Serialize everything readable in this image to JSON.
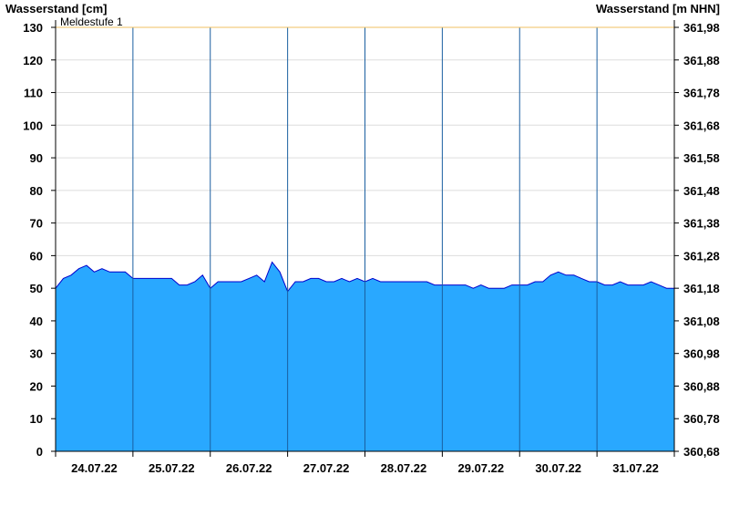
{
  "chart_data": {
    "type": "area",
    "ylabel": "Wasserstand [cm]",
    "ylabel_right": "Wasserstand [m NHN]",
    "ylim": [
      0,
      130
    ],
    "yticks": [
      0,
      10,
      20,
      30,
      40,
      50,
      60,
      70,
      80,
      90,
      100,
      110,
      120,
      130
    ],
    "yticks_right": [
      "360,68",
      "360,78",
      "360,88",
      "360,98",
      "361,08",
      "361,18",
      "361,28",
      "361,38",
      "361,48",
      "361,58",
      "361,68",
      "361,78",
      "361,88",
      "361,98"
    ],
    "xlim": [
      0,
      8
    ],
    "x_labels": [
      "24.07.22",
      "25.07.22",
      "26.07.22",
      "27.07.22",
      "28.07.22",
      "29.07.22",
      "30.07.22",
      "31.07.22"
    ],
    "threshold": {
      "label": "Meldestufe 1",
      "value": 130,
      "color": "#f0c060"
    },
    "grid": true,
    "colors": {
      "fill": "#29a8ff",
      "line": "#0000cc",
      "grid": "#dddddd",
      "day_line": "#1a5fa0"
    },
    "x": [
      0,
      0.1,
      0.2,
      0.3,
      0.4,
      0.5,
      0.6,
      0.7,
      0.8,
      0.9,
      1.0,
      1.1,
      1.2,
      1.3,
      1.4,
      1.5,
      1.6,
      1.7,
      1.8,
      1.9,
      2.0,
      2.1,
      2.2,
      2.3,
      2.4,
      2.5,
      2.6,
      2.7,
      2.8,
      2.9,
      3.0,
      3.1,
      3.2,
      3.3,
      3.4,
      3.5,
      3.6,
      3.7,
      3.8,
      3.9,
      4.0,
      4.1,
      4.2,
      4.3,
      4.4,
      4.5,
      4.6,
      4.7,
      4.8,
      4.9,
      5.0,
      5.1,
      5.2,
      5.3,
      5.4,
      5.5,
      5.6,
      5.7,
      5.8,
      5.9,
      6.0,
      6.1,
      6.2,
      6.3,
      6.4,
      6.5,
      6.6,
      6.7,
      6.8,
      6.9,
      7.0,
      7.1,
      7.2,
      7.3,
      7.4,
      7.5,
      7.6,
      7.7,
      7.8,
      7.9,
      8.0
    ],
    "y": [
      50,
      53,
      54,
      56,
      57,
      55,
      56,
      55,
      55,
      55,
      53,
      53,
      53,
      53,
      53,
      53,
      51,
      51,
      52,
      54,
      50,
      52,
      52,
      52,
      52,
      53,
      54,
      52,
      58,
      55,
      49,
      52,
      52,
      53,
      53,
      52,
      52,
      53,
      52,
      53,
      52,
      53,
      52,
      52,
      52,
      52,
      52,
      52,
      52,
      51,
      51,
      51,
      51,
      51,
      50,
      51,
      50,
      50,
      50,
      51,
      51,
      51,
      52,
      52,
      54,
      55,
      54,
      54,
      53,
      52,
      52,
      51,
      51,
      52,
      51,
      51,
      51,
      52,
      51,
      50,
      50
    ]
  }
}
